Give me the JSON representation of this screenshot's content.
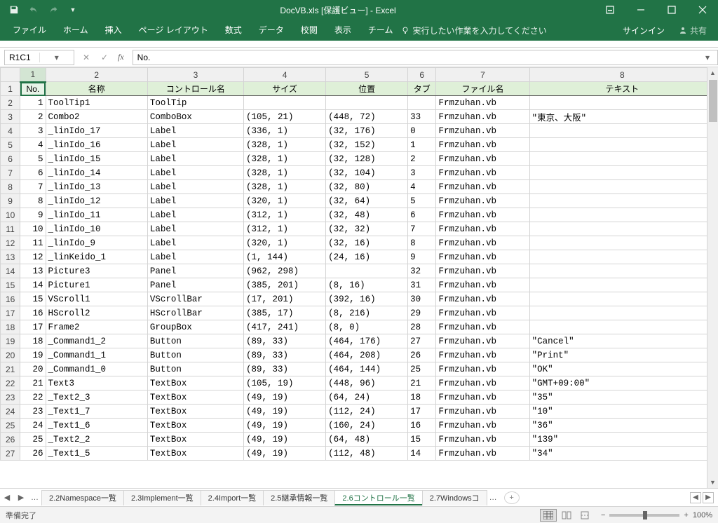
{
  "title": "DocVB.xls [保護ビュー] - Excel",
  "ribbon_tabs": [
    "ファイル",
    "ホーム",
    "挿入",
    "ページ レイアウト",
    "数式",
    "データ",
    "校閲",
    "表示",
    "チーム"
  ],
  "tellme": "実行したい作業を入力してください",
  "signin": "サインイン",
  "share": "共有",
  "namebox": "R1C1",
  "formula": "No.",
  "col_letters": [
    "1",
    "2",
    "3",
    "4",
    "5",
    "6",
    "7",
    "8"
  ],
  "headers": [
    "No.",
    "名称",
    "コントロール名",
    "サイズ",
    "位置",
    "タブ",
    "ファイル名",
    "テキスト"
  ],
  "rows": [
    {
      "n": 1,
      "name": "ToolTip1",
      "ctrl": "ToolTip",
      "size": "",
      "pos": "",
      "tab": "",
      "file": "Frmzuhan.vb",
      "text": ""
    },
    {
      "n": 2,
      "name": "Combo2",
      "ctrl": "ComboBox",
      "size": "(105, 21)",
      "pos": "(448, 72)",
      "tab": "33",
      "file": "Frmzuhan.vb",
      "text": "\"東京、大阪\""
    },
    {
      "n": 3,
      "name": "_linIdo_17",
      "ctrl": "Label",
      "size": "(336, 1)",
      "pos": "(32, 176)",
      "tab": "0",
      "file": "Frmzuhan.vb",
      "text": ""
    },
    {
      "n": 4,
      "name": "_linIdo_16",
      "ctrl": "Label",
      "size": "(328, 1)",
      "pos": "(32, 152)",
      "tab": "1",
      "file": "Frmzuhan.vb",
      "text": ""
    },
    {
      "n": 5,
      "name": "_linIdo_15",
      "ctrl": "Label",
      "size": "(328, 1)",
      "pos": "(32, 128)",
      "tab": "2",
      "file": "Frmzuhan.vb",
      "text": ""
    },
    {
      "n": 6,
      "name": "_linIdo_14",
      "ctrl": "Label",
      "size": "(328, 1)",
      "pos": "(32, 104)",
      "tab": "3",
      "file": "Frmzuhan.vb",
      "text": ""
    },
    {
      "n": 7,
      "name": "_linIdo_13",
      "ctrl": "Label",
      "size": "(328, 1)",
      "pos": "(32, 80)",
      "tab": "4",
      "file": "Frmzuhan.vb",
      "text": ""
    },
    {
      "n": 8,
      "name": "_linIdo_12",
      "ctrl": "Label",
      "size": "(320, 1)",
      "pos": "(32, 64)",
      "tab": "5",
      "file": "Frmzuhan.vb",
      "text": ""
    },
    {
      "n": 9,
      "name": "_linIdo_11",
      "ctrl": "Label",
      "size": "(312, 1)",
      "pos": "(32, 48)",
      "tab": "6",
      "file": "Frmzuhan.vb",
      "text": ""
    },
    {
      "n": 10,
      "name": "_linIdo_10",
      "ctrl": "Label",
      "size": "(312, 1)",
      "pos": "(32, 32)",
      "tab": "7",
      "file": "Frmzuhan.vb",
      "text": ""
    },
    {
      "n": 11,
      "name": "_linIdo_9",
      "ctrl": "Label",
      "size": "(320, 1)",
      "pos": "(32, 16)",
      "tab": "8",
      "file": "Frmzuhan.vb",
      "text": ""
    },
    {
      "n": 12,
      "name": "_linKeido_1",
      "ctrl": "Label",
      "size": "(1, 144)",
      "pos": "(24, 16)",
      "tab": "9",
      "file": "Frmzuhan.vb",
      "text": ""
    },
    {
      "n": 13,
      "name": "Picture3",
      "ctrl": "Panel",
      "size": "(962, 298)",
      "pos": "",
      "tab": "32",
      "file": "Frmzuhan.vb",
      "text": ""
    },
    {
      "n": 14,
      "name": "Picture1",
      "ctrl": "Panel",
      "size": "(385, 201)",
      "pos": "(8, 16)",
      "tab": "31",
      "file": "Frmzuhan.vb",
      "text": ""
    },
    {
      "n": 15,
      "name": "VScroll1",
      "ctrl": "VScrollBar",
      "size": "(17, 201)",
      "pos": "(392, 16)",
      "tab": "30",
      "file": "Frmzuhan.vb",
      "text": ""
    },
    {
      "n": 16,
      "name": "HScroll2",
      "ctrl": "HScrollBar",
      "size": "(385, 17)",
      "pos": "(8, 216)",
      "tab": "29",
      "file": "Frmzuhan.vb",
      "text": ""
    },
    {
      "n": 17,
      "name": "Frame2",
      "ctrl": "GroupBox",
      "size": "(417, 241)",
      "pos": "(8, 0)",
      "tab": "28",
      "file": "Frmzuhan.vb",
      "text": ""
    },
    {
      "n": 18,
      "name": "_Command1_2",
      "ctrl": "Button",
      "size": "(89, 33)",
      "pos": "(464, 176)",
      "tab": "27",
      "file": "Frmzuhan.vb",
      "text": "\"Cancel\""
    },
    {
      "n": 19,
      "name": "_Command1_1",
      "ctrl": "Button",
      "size": "(89, 33)",
      "pos": "(464, 208)",
      "tab": "26",
      "file": "Frmzuhan.vb",
      "text": "\"Print\""
    },
    {
      "n": 20,
      "name": "_Command1_0",
      "ctrl": "Button",
      "size": "(89, 33)",
      "pos": "(464, 144)",
      "tab": "25",
      "file": "Frmzuhan.vb",
      "text": "\"OK\""
    },
    {
      "n": 21,
      "name": "Text3",
      "ctrl": "TextBox",
      "size": "(105, 19)",
      "pos": "(448, 96)",
      "tab": "21",
      "file": "Frmzuhan.vb",
      "text": "\"GMT+09:00\""
    },
    {
      "n": 22,
      "name": "_Text2_3",
      "ctrl": "TextBox",
      "size": "(49, 19)",
      "pos": "(64, 24)",
      "tab": "18",
      "file": "Frmzuhan.vb",
      "text": "\"35\""
    },
    {
      "n": 23,
      "name": "_Text1_7",
      "ctrl": "TextBox",
      "size": "(49, 19)",
      "pos": "(112, 24)",
      "tab": "17",
      "file": "Frmzuhan.vb",
      "text": "\"10\""
    },
    {
      "n": 24,
      "name": "_Text1_6",
      "ctrl": "TextBox",
      "size": "(49, 19)",
      "pos": "(160, 24)",
      "tab": "16",
      "file": "Frmzuhan.vb",
      "text": "\"36\""
    },
    {
      "n": 25,
      "name": "_Text2_2",
      "ctrl": "TextBox",
      "size": "(49, 19)",
      "pos": "(64, 48)",
      "tab": "15",
      "file": "Frmzuhan.vb",
      "text": "\"139\""
    },
    {
      "n": 26,
      "name": "_Text1_5",
      "ctrl": "TextBox",
      "size": "(49, 19)",
      "pos": "(112, 48)",
      "tab": "14",
      "file": "Frmzuhan.vb",
      "text": "\"34\""
    }
  ],
  "ws_tabs": [
    "2.2Namespace一覧",
    "2.3Implement一覧",
    "2.4Import一覧",
    "2.5継承情報一覧",
    "2.6コントロール一覧",
    "2.7Windowsコ"
  ],
  "ws_active": 4,
  "status_ready": "準備完了",
  "zoom": "100%"
}
